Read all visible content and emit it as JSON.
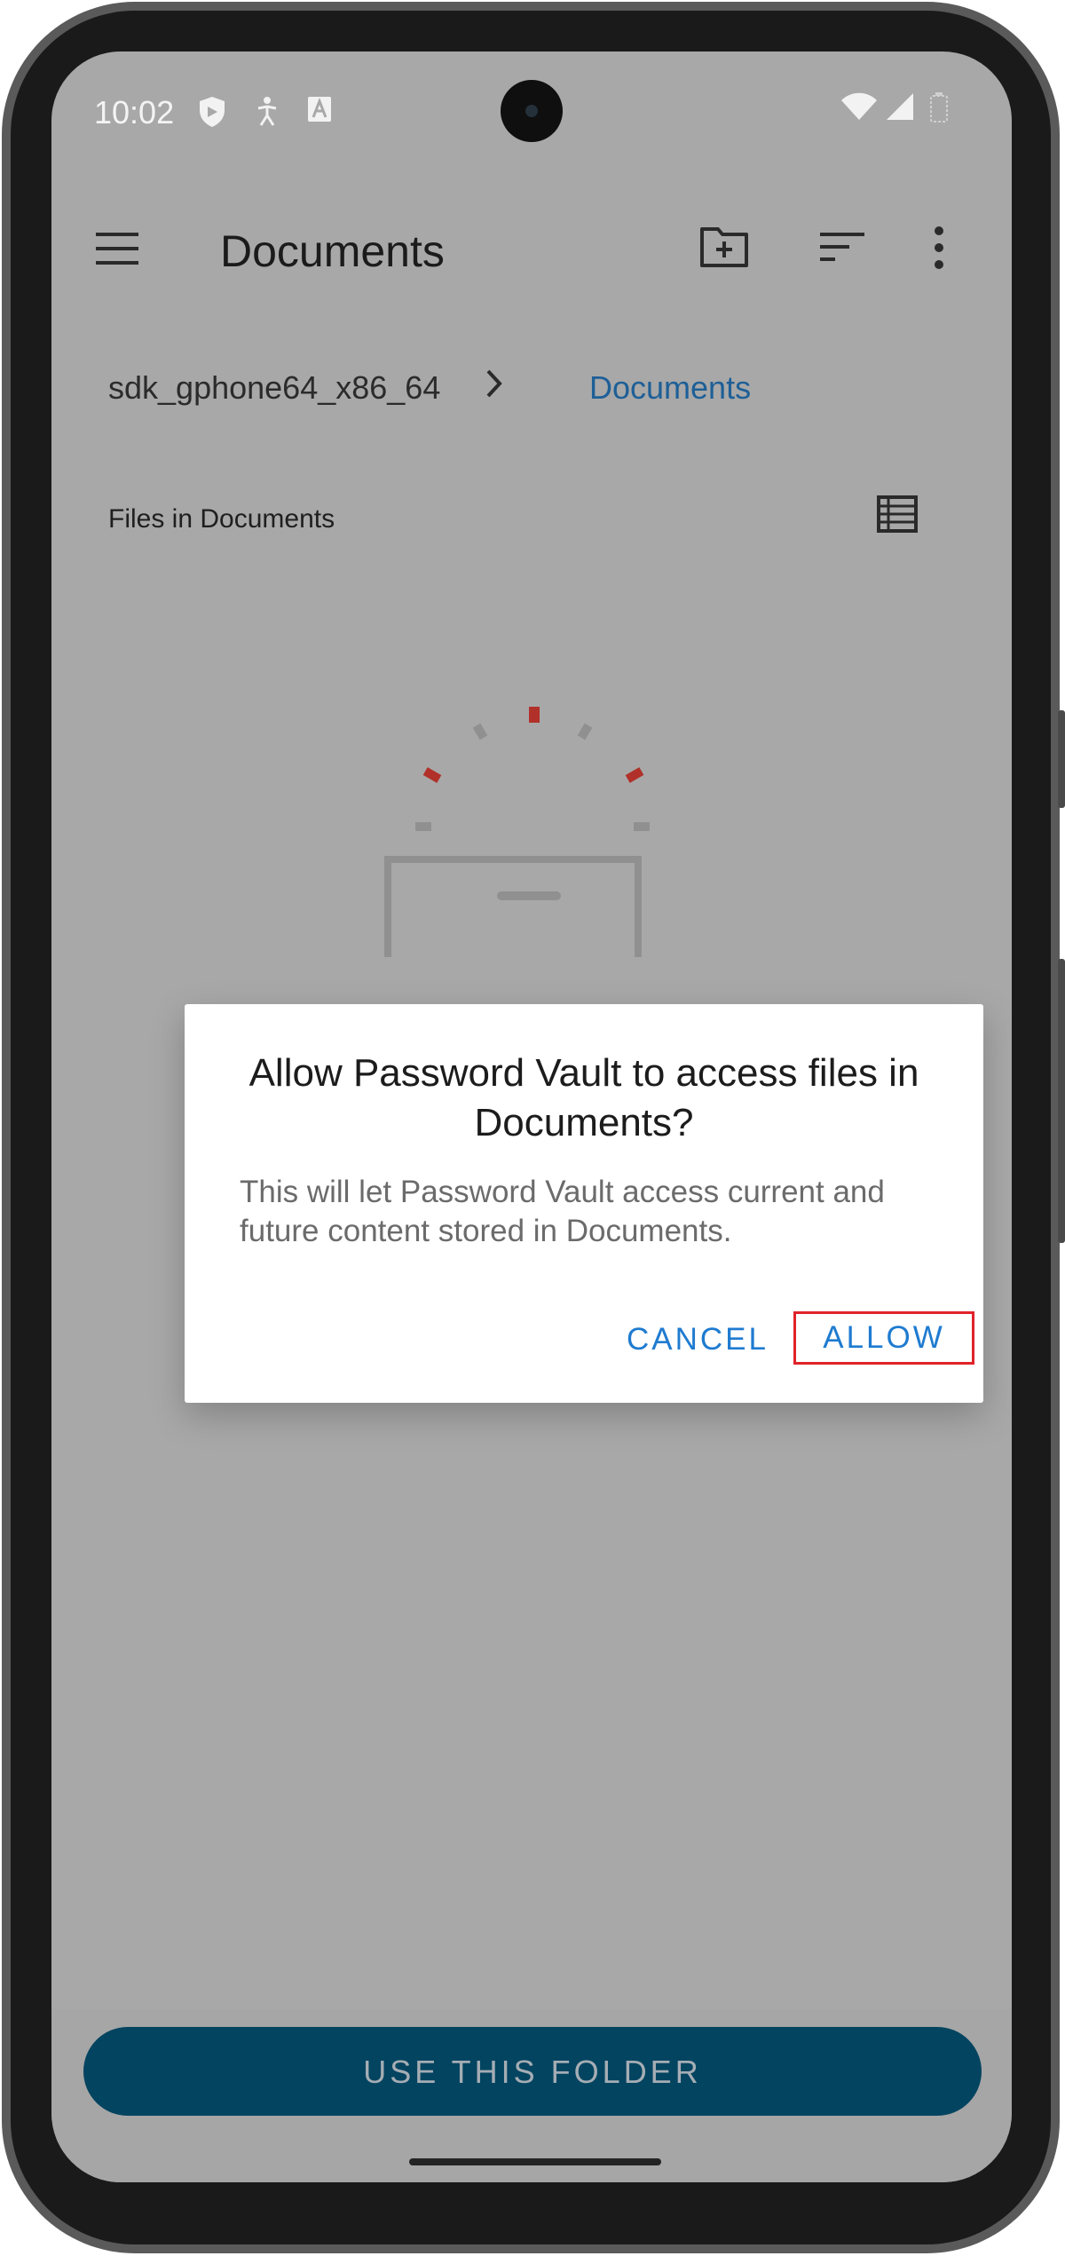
{
  "status_bar": {
    "time": "10:02",
    "icons": [
      "shield-icon",
      "accessibility-icon",
      "text-icon",
      "wifi-icon",
      "signal-icon",
      "battery-icon"
    ]
  },
  "app_bar": {
    "title": "Documents",
    "icons": [
      "menu-icon",
      "new-folder-icon",
      "sort-icon",
      "more-vert-icon"
    ]
  },
  "breadcrumb": {
    "root": "sdk_gphone64_x86_64",
    "current": "Documents"
  },
  "files": {
    "label": "Files in Documents"
  },
  "dialog": {
    "title": "Allow Password Vault to access files in Documents?",
    "message": "This will let Password Vault access current and future content stored in Documents.",
    "cancel": "CANCEL",
    "allow": "ALLOW"
  },
  "bottom": {
    "use_folder": "USE THIS FOLDER"
  },
  "colors": {
    "screen_scrim": "#a8a8a8",
    "accent_blue": "#1f7bd0",
    "primary_button": "#034460",
    "highlight_red": "#e0232a"
  }
}
